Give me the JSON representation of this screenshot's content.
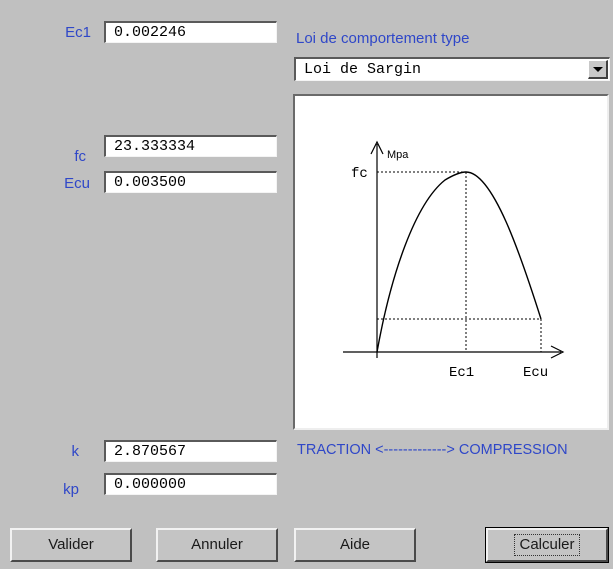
{
  "fields": {
    "ec1": {
      "label": "Ec1",
      "value": "0.002246"
    },
    "fc": {
      "label": "fc",
      "value": "23.333334"
    },
    "ecu": {
      "label": "Ecu",
      "value": "0.003500"
    },
    "k": {
      "label": "k",
      "value": "2.870567"
    },
    "kp": {
      "label": "kp",
      "value": "0.000000"
    }
  },
  "law": {
    "title": "Loi de comportement type",
    "selected": "Loi de Sargin"
  },
  "graph": {
    "y_unit": "Mpa",
    "y_label": "fc",
    "x_label_peak": "Ec1",
    "x_label_end": "Ecu"
  },
  "direction_text": "TRACTION <-------------> COMPRESSION",
  "buttons": {
    "validate": "Valider",
    "cancel": "Annuler",
    "help": "Aide",
    "compute": "Calculer"
  },
  "icons": {
    "dropdown": "chevron-down-icon"
  }
}
